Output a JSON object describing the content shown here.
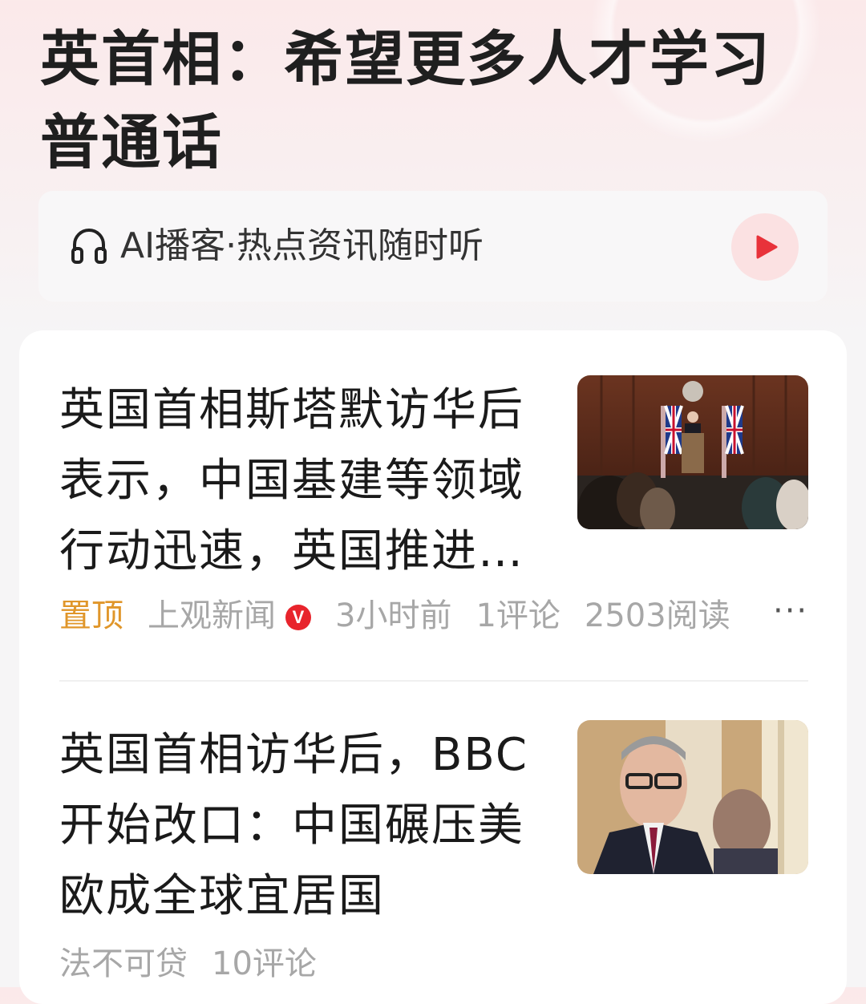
{
  "topic": {
    "title": "英首相：希望更多人才学习普通话"
  },
  "podcast": {
    "icon": "headphones-icon",
    "label": "AI播客·热点资讯随时听",
    "play_icon": "play-icon",
    "accent": "#e8323a"
  },
  "feed": {
    "articles": [
      {
        "title": "英国首相斯塔默访华后表示，中国基建等领域行动迅速，英国推进…",
        "pinned_label": "置顶",
        "source": "上观新闻",
        "verified_badge": "V",
        "time": "3小时前",
        "comments": "1评论",
        "reads": "2503阅读",
        "more_label": "···"
      },
      {
        "title": "英国首相访华后，BBC开始改口：中国碾压美欧成全球宜居国",
        "source": "法不可贷",
        "comments": "10评论"
      }
    ]
  },
  "colors": {
    "pinned": "#e0962a",
    "badge": "#e8242c",
    "meta_text": "#a7a7a7"
  }
}
